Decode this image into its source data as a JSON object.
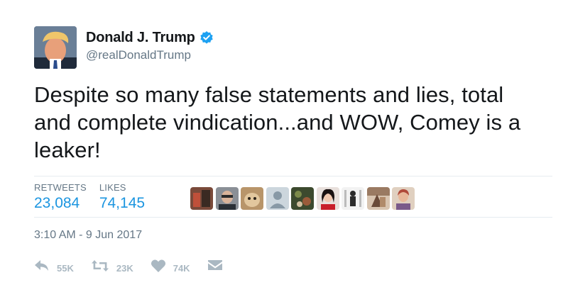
{
  "author": {
    "name": "Donald J. Trump",
    "handle": "@realDonaldTrump",
    "verified_icon": "verified-badge-icon",
    "verified_color": "#1da1f2"
  },
  "tweet": {
    "text": "Despite so many false statements and lies, total and complete vindication...and WOW, Comey is a leaker!"
  },
  "stats": {
    "retweets_label": "RETWEETS",
    "retweets_value": "23,084",
    "likes_label": "LIKES",
    "likes_value": "74,145"
  },
  "timestamp": "3:10 AM - 9 Jun 2017",
  "actions": {
    "reply_count": "55K",
    "retweet_count": "23K",
    "like_count": "74K",
    "reply_icon": "reply-icon",
    "retweet_icon": "retweet-icon",
    "like_icon": "heart-icon",
    "dm_icon": "envelope-icon"
  },
  "colors": {
    "link_blue": "#1b95e0",
    "secondary_text": "#657786",
    "action_icon": "#aab8c2",
    "divider": "#e6ecf0"
  }
}
